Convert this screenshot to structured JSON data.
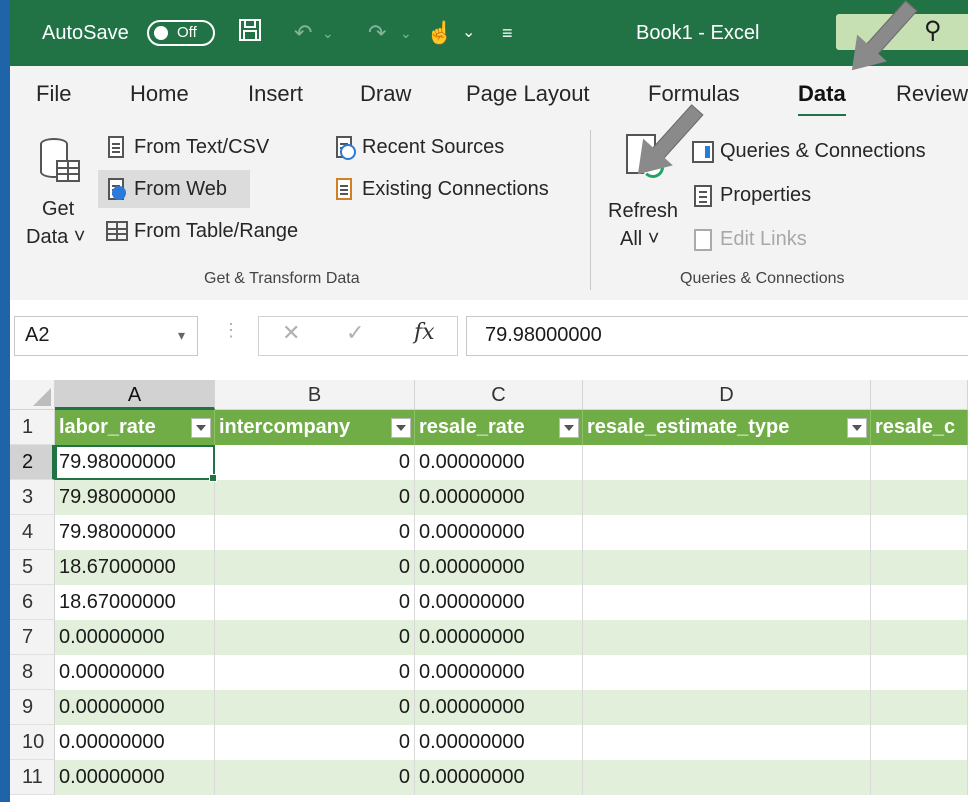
{
  "titlebar": {
    "autosave_label": "AutoSave",
    "autosave_state": "Off",
    "book_title": "Book1  -  Excel",
    "icons": [
      "save-icon",
      "undo-icon",
      "redo-icon",
      "touch-mode-icon",
      "customize-icon",
      "search-icon"
    ]
  },
  "tabs": [
    "File",
    "Home",
    "Insert",
    "Draw",
    "Page Layout",
    "Formulas",
    "Data",
    "Review"
  ],
  "active_tab": "Data",
  "ribbon": {
    "get_data": [
      "Get",
      "Data ˅"
    ],
    "from_text_csv": "From Text/CSV",
    "from_web": "From Web",
    "from_table_range": "From Table/Range",
    "recent_sources": "Recent Sources",
    "existing_connections": "Existing Connections",
    "group_get_transform": "Get & Transform Data",
    "refresh_all": [
      "Refresh",
      "All ˅"
    ],
    "queries_connections": "Queries & Connections",
    "properties": "Properties",
    "edit_links": "Edit Links",
    "group_queries": "Queries & Connections"
  },
  "formula_bar": {
    "name_box": "A2",
    "formula": "79.98000000"
  },
  "grid": {
    "columns": [
      "A",
      "B",
      "C",
      "D"
    ],
    "selected_column": "A",
    "header_row": [
      "labor_rate",
      "intercompany",
      "resale_rate",
      "resale_estimate_type",
      "resale_c"
    ],
    "rows": [
      {
        "n": "1"
      },
      {
        "n": "2",
        "a": "79.98000000",
        "b": "0",
        "c": "0.00000000"
      },
      {
        "n": "3",
        "a": "79.98000000",
        "b": "0",
        "c": "0.00000000"
      },
      {
        "n": "4",
        "a": "79.98000000",
        "b": "0",
        "c": "0.00000000"
      },
      {
        "n": "5",
        "a": "18.67000000",
        "b": "0",
        "c": "0.00000000"
      },
      {
        "n": "6",
        "a": "18.67000000",
        "b": "0",
        "c": "0.00000000"
      },
      {
        "n": "7",
        "a": "0.00000000",
        "b": "0",
        "c": "0.00000000"
      },
      {
        "n": "8",
        "a": "0.00000000",
        "b": "0",
        "c": "0.00000000"
      },
      {
        "n": "9",
        "a": "0.00000000",
        "b": "0",
        "c": "0.00000000"
      },
      {
        "n": "10",
        "a": "0.00000000",
        "b": "0",
        "c": "0.00000000"
      },
      {
        "n": "11",
        "a": "0.00000000",
        "b": "0",
        "c": "0.00000000"
      }
    ]
  },
  "colors": {
    "excel_green": "#217346",
    "table_header": "#70ad47",
    "table_band": "#e2efda",
    "background_blue": "#1f63a8"
  }
}
